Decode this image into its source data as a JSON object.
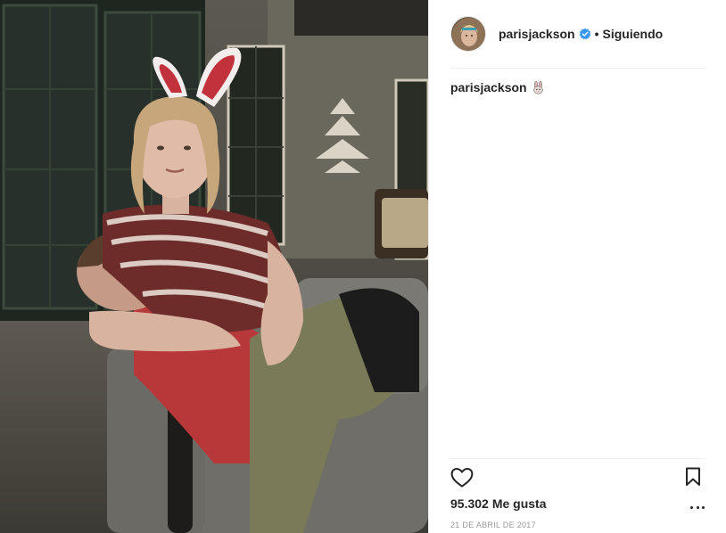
{
  "post": {
    "photo": {
      "icon": "photo-image"
    },
    "header": {
      "username": "parisjackson",
      "verified": true,
      "separator": "•",
      "follow_state": "Siguiendo",
      "avatar_icon": "avatar-image"
    },
    "caption": {
      "username": "parisjackson",
      "emoji_icon": "rabbit-icon"
    },
    "actions": {
      "like_icon": "heart-icon",
      "save_icon": "bookmark-icon",
      "more_icon": "more-options-icon"
    },
    "likes": {
      "count": "95.302",
      "label": "Me gusta"
    },
    "date": "21 DE ABRIL DE 2017"
  },
  "colors": {
    "text": "#262626",
    "muted": "#999999",
    "divider": "#efefef",
    "verified": "#3897f0"
  }
}
